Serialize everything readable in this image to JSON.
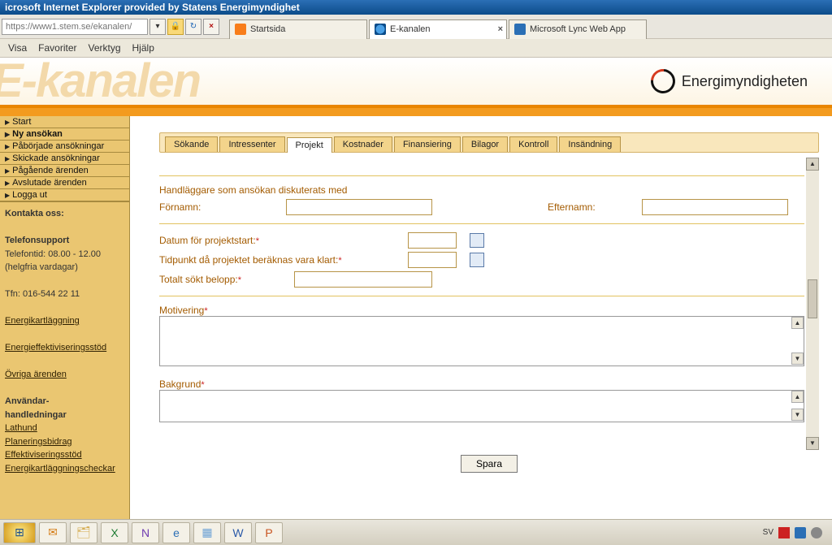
{
  "window": {
    "title": "icrosoft Internet Explorer provided by Statens Energimyndighet"
  },
  "address": {
    "url_placeholder": "https://www1.stem.se/ekanalen/"
  },
  "browser_tabs": [
    {
      "label": "Startsida",
      "active": false
    },
    {
      "label": "E-kanalen",
      "active": true
    },
    {
      "label": "Microsoft Lync Web App",
      "active": false
    }
  ],
  "menubar": {
    "visa": "Visa",
    "favoriter": "Favoriter",
    "verktyg": "Verktyg",
    "hjalp": "Hjälp"
  },
  "banner": {
    "text": "E-kanalen",
    "logo_text": "Energimyndigheten"
  },
  "sidebar": {
    "items": [
      {
        "label": "Start"
      },
      {
        "label": "Ny ansökan",
        "selected": true
      },
      {
        "label": "Påbörjade ansökningar"
      },
      {
        "label": "Skickade ansökningar"
      },
      {
        "label": "Pågående ärenden"
      },
      {
        "label": "Avslutade ärenden"
      },
      {
        "label": "Logga ut"
      }
    ],
    "contact_heading": "Kontakta oss:",
    "phone_heading": "Telefonsupport",
    "phone_hours": "Telefontid: 08.00 - 12.00",
    "phone_days": "(helgfria vardagar)",
    "phone_no": "Tfn: 016-544 22 11",
    "links1": [
      {
        "label": "Energikartläggning"
      },
      {
        "label": "Energieffektiviseringsstöd"
      },
      {
        "label": "Övriga ärenden"
      }
    ],
    "guides_heading1": "Användar-",
    "guides_heading2": "handledningar",
    "links2": [
      {
        "label": "Lathund"
      },
      {
        "label": "Planeringsbidrag"
      },
      {
        "label": "Effektiviseringsstöd"
      },
      {
        "label": "Energikartläggningscheckar"
      }
    ]
  },
  "form": {
    "tabs": [
      {
        "label": "Sökande"
      },
      {
        "label": "Intressenter"
      },
      {
        "label": "Projekt",
        "active": true
      },
      {
        "label": "Kostnader"
      },
      {
        "label": "Finansiering"
      },
      {
        "label": "Bilagor"
      },
      {
        "label": "Kontroll"
      },
      {
        "label": "Insändning"
      }
    ],
    "section1_title": "Handläggare som ansökan diskuterats med",
    "fornamn_label": "Förnamn:",
    "efternamn_label": "Efternamn:",
    "fornamn_value": "",
    "efternamn_value": "",
    "datum_start_label": "Datum för projektstart:",
    "datum_start_value": "",
    "datum_klart_label": "Tidpunkt då projektet beräknas vara klart:",
    "datum_klart_value": "",
    "totalt_label": "Totalt sökt belopp:",
    "totalt_value": "",
    "motivering_label": "Motivering",
    "motivering_value": "",
    "bakgrund_label": "Bakgrund",
    "bakgrund_value": "",
    "spara_label": "Spara"
  },
  "tray": {
    "lang": "SV"
  }
}
